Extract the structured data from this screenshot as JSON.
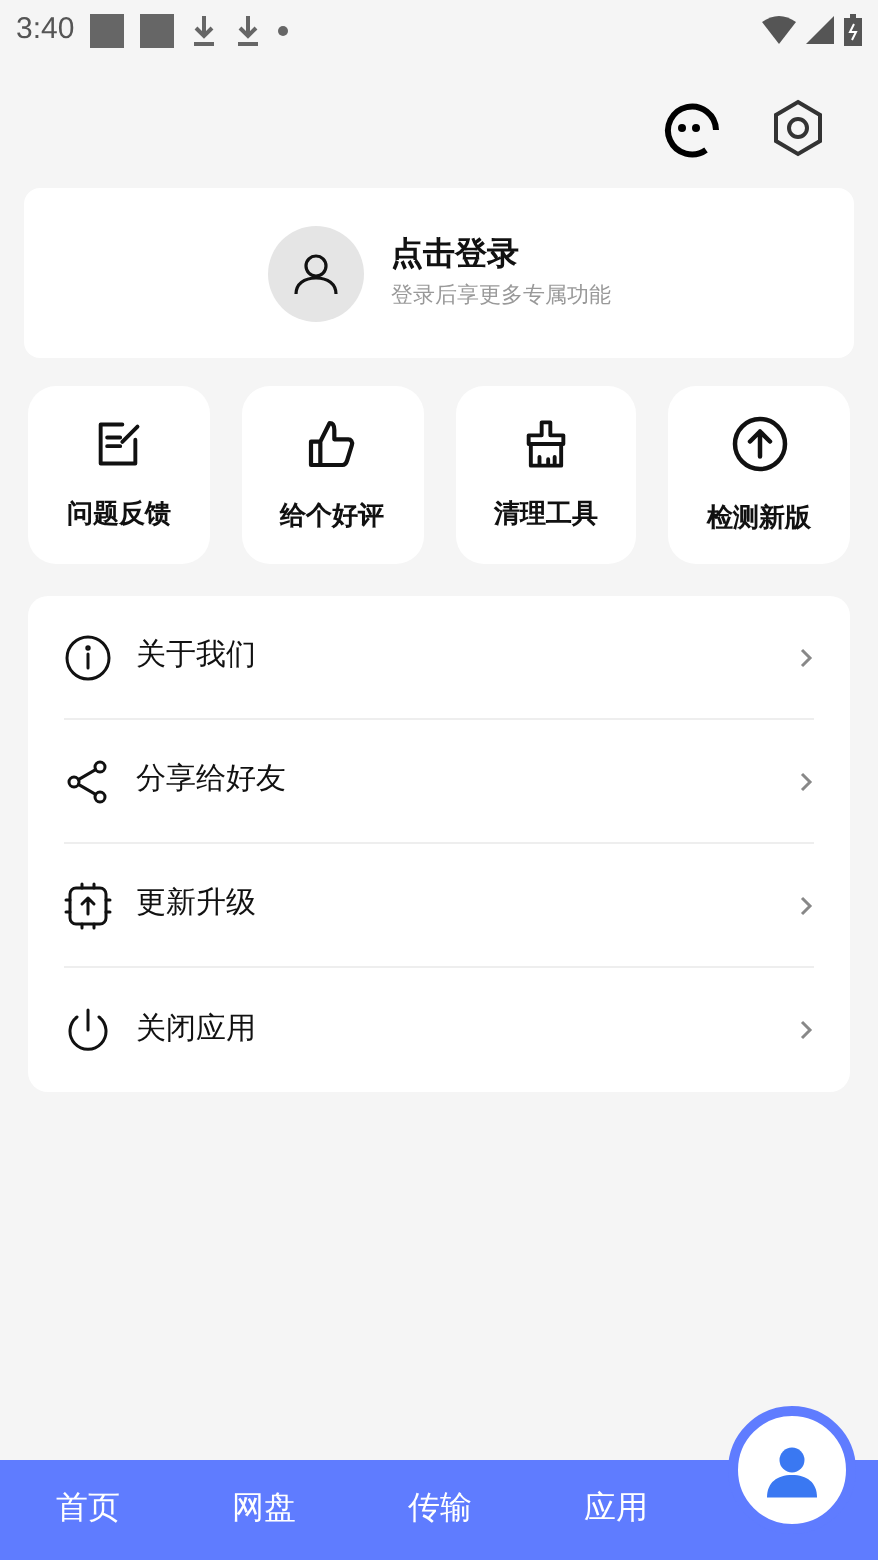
{
  "status_bar": {
    "time": "3:40"
  },
  "login_card": {
    "title": "点击登录",
    "subtitle": "登录后享更多专属功能"
  },
  "quick_actions": [
    {
      "kind": "edit",
      "label": "问题反馈"
    },
    {
      "kind": "thumb",
      "label": "给个好评"
    },
    {
      "kind": "brush",
      "label": "清理工具"
    },
    {
      "kind": "upload",
      "label": "检测新版"
    }
  ],
  "menu": [
    {
      "kind": "info",
      "label": "关于我们"
    },
    {
      "kind": "share",
      "label": "分享给好友"
    },
    {
      "kind": "chip",
      "label": "更新升级"
    },
    {
      "kind": "power",
      "label": "关闭应用"
    }
  ],
  "bottom_nav": [
    {
      "label": "首页",
      "selected": false
    },
    {
      "label": "网盘",
      "selected": false
    },
    {
      "label": "传输",
      "selected": false
    },
    {
      "label": "应用",
      "selected": false
    },
    {
      "kind": "profile",
      "selected": true
    }
  ]
}
